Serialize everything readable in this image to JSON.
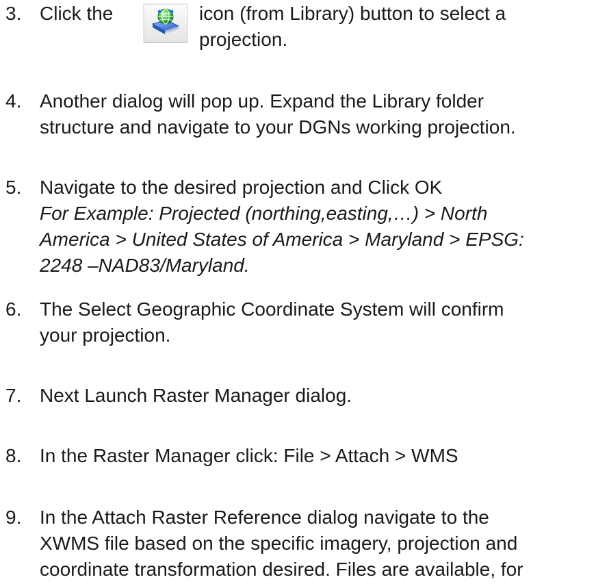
{
  "steps": [
    {
      "number": "3.",
      "lines": [
        "Click the",
        "icon (from Library) button to select a",
        "projection."
      ],
      "icon": "globe-library-icon"
    },
    {
      "number": "4.",
      "lines": [
        "Another dialog will pop up. Expand the Library folder",
        "structure and navigate to your DGNs working projection."
      ]
    },
    {
      "number": "5.",
      "lines": [
        "Navigate to the desired projection and Click OK"
      ],
      "example_lines": [
        "For Example: Projected (northing,easting,…) > North",
        "America > United States of America > Maryland > EPSG:",
        "2248 –NAD83/Maryland."
      ]
    },
    {
      "number": "6.",
      "lines": [
        "The Select Geographic Coordinate System will confirm",
        "your projection."
      ]
    },
    {
      "number": "7.",
      "lines": [
        "Next Launch Raster Manager dialog."
      ]
    },
    {
      "number": "8.",
      "lines": [
        "In the Raster Manager click: File > Attach > WMS"
      ]
    },
    {
      "number": "9.",
      "lines": [
        "In the Attach Raster Reference dialog navigate to the",
        "XWMS file based on the specific imagery, projection and",
        "coordinate transformation desired. Files are available, for"
      ]
    }
  ]
}
